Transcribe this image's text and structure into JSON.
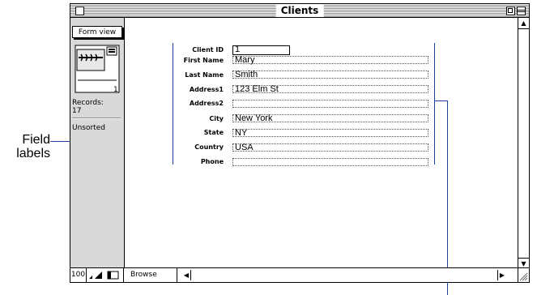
{
  "window": {
    "title": "Clients"
  },
  "status_area": {
    "layout_button_label": "Form view",
    "book_page": "1",
    "records_label": "Records:",
    "records_value": "17",
    "sort_status": "Unsorted"
  },
  "fields": [
    {
      "label": "Client ID",
      "value": "1"
    },
    {
      "label": "First Name",
      "value": "Mary"
    },
    {
      "label": "Last Name",
      "value": "Smith"
    },
    {
      "label": "Address1",
      "value": "123 Elm St"
    },
    {
      "label": "Address2",
      "value": ""
    },
    {
      "label": "City",
      "value": "New York"
    },
    {
      "label": "State",
      "value": "NY"
    },
    {
      "label": "Country",
      "value": "USA"
    },
    {
      "label": "Phone",
      "value": ""
    }
  ],
  "bottom_bar": {
    "zoom": "100",
    "mode": "Browse"
  },
  "annotation": {
    "callout_line1": "Field",
    "callout_line2": "labels"
  },
  "colors": {
    "annotation_line": "#1f3f9a",
    "status_area_bg": "#d9d9d9"
  }
}
